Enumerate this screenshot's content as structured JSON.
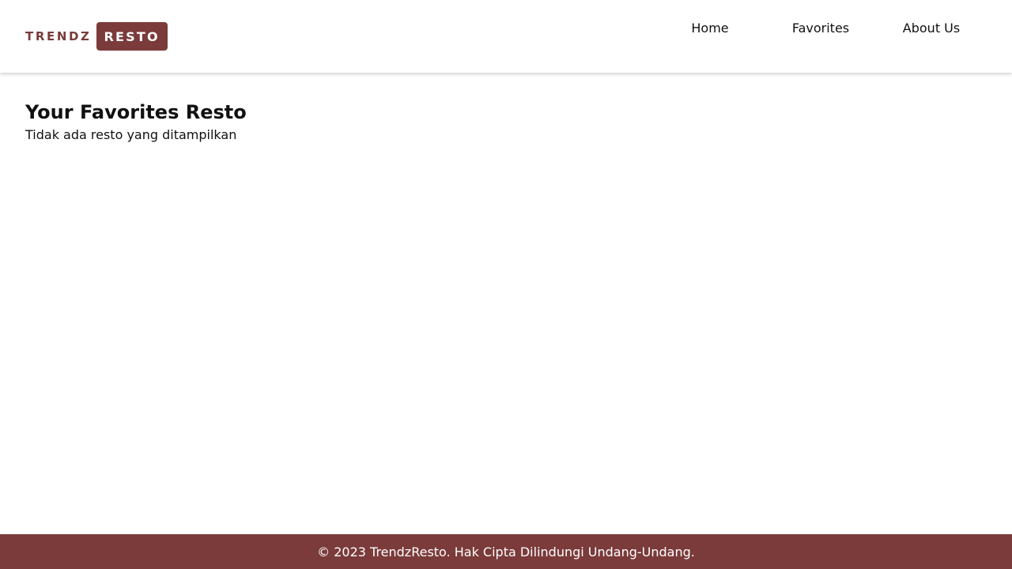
{
  "brand": {
    "part1": "TRENDZ",
    "part2": "RESTO",
    "color": "#7b3b3b"
  },
  "nav": {
    "items": [
      {
        "label": "Home"
      },
      {
        "label": "Favorites"
      },
      {
        "label": "About Us"
      }
    ]
  },
  "main": {
    "title": "Your Favorites Resto",
    "empty_message": "Tidak ada resto yang ditampilkan"
  },
  "footer": {
    "text": "© 2023 TrendzResto. Hak Cipta Dilindungi Undang-Undang.",
    "background": "#7b3b3b"
  }
}
